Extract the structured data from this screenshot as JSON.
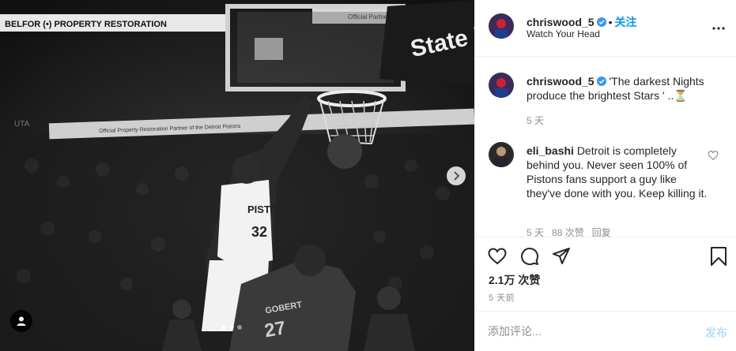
{
  "post_author": {
    "username": "chriswood_5",
    "verified": true,
    "follow_label": "关注",
    "location": "Watch Your Head"
  },
  "caption": {
    "username": "chriswood_5",
    "text": "'The darkest Nights produce the brightest Stars ' ..⏳",
    "time": "5 天"
  },
  "comments": [
    {
      "username": "eli_bashi",
      "text": "Detroit is completely behind you. Never seen 100% of Pistons fans support a guy like they've done with you. Keep killing it.",
      "time": "5 天",
      "likes": "88 次赞",
      "reply_label": "回复"
    }
  ],
  "media": {
    "banner_top": "BELFOR (•) PROPERTY RESTORATION",
    "banner_top_right": "Official Partner of",
    "banner_mid": "Official Property Restoration Partner of the Detroit Pistons",
    "backboard_brand": "State F",
    "jersey_front": "PISTONS",
    "jersey_number_front": "32",
    "jersey_back_name": "GOBERT",
    "jersey_back_number": "27",
    "arena_left": "UTA",
    "carousel_count": 3,
    "carousel_active": 0
  },
  "actions": {
    "likes": "2.1万 次赞",
    "posted_time": "5 天前"
  },
  "add_comment": {
    "placeholder": "添加评论...",
    "post_label": "发布"
  },
  "colors": {
    "link_blue": "#0095f6",
    "post_disabled": "#b2dffc",
    "muted": "#8e8e8e",
    "verified_blue": "#3897f0"
  }
}
